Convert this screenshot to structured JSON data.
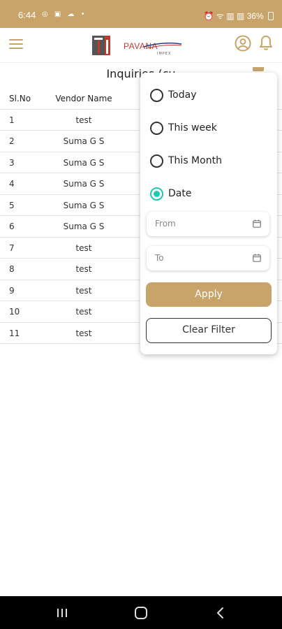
{
  "status_bar": {
    "time": "6:44",
    "left_icons": "◎ ▣ ☁ •",
    "right_icons": "⏰ ᯤ ▥ ▥",
    "battery": "36%"
  },
  "app_bar": {
    "logo_text": "PAVANA",
    "logo_subtext": "IMPEX"
  },
  "page": {
    "title": "Inquiries (cu"
  },
  "table": {
    "headers": {
      "sl": "Sl.No",
      "vendor": "Vendor Name"
    },
    "rows": [
      {
        "sl": "1",
        "vendor": "test"
      },
      {
        "sl": "2",
        "vendor": "Suma G S"
      },
      {
        "sl": "3",
        "vendor": "Suma G S"
      },
      {
        "sl": "4",
        "vendor": "Suma G S"
      },
      {
        "sl": "5",
        "vendor": "Suma G S"
      },
      {
        "sl": "6",
        "vendor": "Suma G S"
      },
      {
        "sl": "7",
        "vendor": "test"
      },
      {
        "sl": "8",
        "vendor": "test"
      },
      {
        "sl": "9",
        "vendor": "test"
      },
      {
        "sl": "10",
        "vendor": "test"
      },
      {
        "sl": "11",
        "vendor": "test"
      }
    ]
  },
  "filter": {
    "options": [
      {
        "label": "Today",
        "selected": false
      },
      {
        "label": "This week",
        "selected": false
      },
      {
        "label": "This Month",
        "selected": false
      },
      {
        "label": "Date",
        "selected": true
      }
    ],
    "from_placeholder": "From",
    "to_placeholder": "To",
    "apply_label": "Apply",
    "clear_label": "Clear Filter"
  },
  "colors": {
    "accent": "#c9a46a",
    "radio_selected": "#1ec8b4",
    "logo_red": "#c0392b"
  },
  "icons": [
    "menu-icon",
    "user-circle-icon",
    "bell-icon",
    "calendar-icon",
    "recents-icon",
    "home-icon",
    "back-icon"
  ]
}
